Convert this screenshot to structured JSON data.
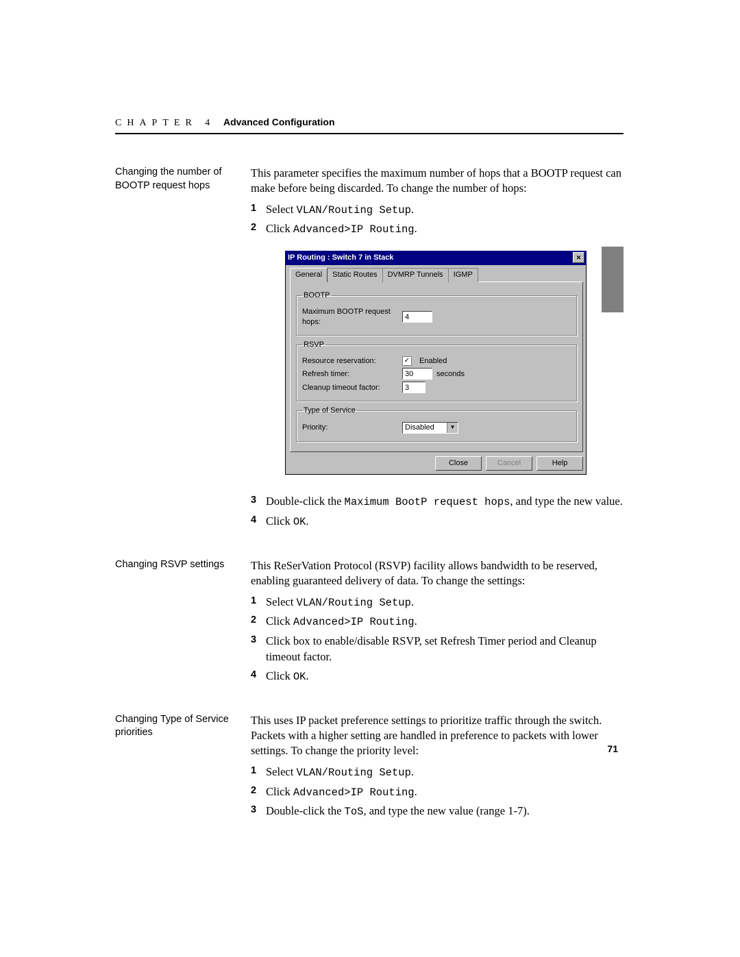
{
  "header": {
    "chapter_label": "CHAPTER 4",
    "title": "Advanced Configuration"
  },
  "sections": {
    "bootp": {
      "side_label": "Changing the number of BOOTP request hops",
      "intro": "This parameter specifies the maximum number of hops that a BOOTP request can make before being discarded. To change the number of hops:",
      "step1_pre": "Select ",
      "step1_mono": "VLAN/Routing Setup",
      "step1_post": ".",
      "step2_pre": "Click ",
      "step2_mono": "Advanced>IP Routing",
      "step2_post": ".",
      "step3_pre": "Double-click the ",
      "step3_mono": "Maximum BootP request hops",
      "step3_post": ", and type the new value.",
      "step4_pre": "Click ",
      "step4_mono": "OK",
      "step4_post": "."
    },
    "rsvp": {
      "side_label": "Changing RSVP settings",
      "intro": "This ReSerVation Protocol (RSVP) facility allows bandwidth to be reserved, enabling guaranteed delivery of data. To change the settings:",
      "step1_pre": "Select ",
      "step1_mono": "VLAN/Routing Setup",
      "step1_post": ".",
      "step2_pre": "Click ",
      "step2_mono": "Advanced>IP Routing",
      "step2_post": ".",
      "step3": "Click box to enable/disable RSVP, set Refresh Timer period and Cleanup timeout factor.",
      "step4_pre": "Click ",
      "step4_mono": "OK",
      "step4_post": "."
    },
    "tos": {
      "side_label": "Changing Type of Service priorities",
      "intro": "This uses IP packet preference settings to prioritize traffic through the switch. Packets with a higher setting are handled in preference to packets with lower settings. To change the priority level:",
      "step1_pre": "Select ",
      "step1_mono": "VLAN/Routing Setup",
      "step1_post": ".",
      "step2_pre": "Click ",
      "step2_mono": "Advanced>IP Routing",
      "step2_post": ".",
      "step3_pre": "Double-click the  ",
      "step3_mono": "ToS",
      "step3_post": ", and type the new value (range 1-7)."
    }
  },
  "dialog": {
    "title": "IP Routing : Switch 7 in Stack",
    "tabs": {
      "general": "General",
      "static": "Static Routes",
      "dvmrp": "DVMRP Tunnels",
      "igmp": "IGMP"
    },
    "groups": {
      "bootp_legend": "BOOTP",
      "bootp_label": "Maximum BOOTP request hops:",
      "bootp_value": "4",
      "rsvp_legend": "RSVP",
      "rsvp_res_label": "Resource reservation:",
      "rsvp_enabled": "Enabled",
      "rsvp_refresh_label": "Refresh timer:",
      "rsvp_refresh_value": "30",
      "rsvp_refresh_unit": "seconds",
      "rsvp_cleanup_label": "Cleanup timeout factor:",
      "rsvp_cleanup_value": "3",
      "tos_legend": "Type of Service",
      "tos_priority_label": "Priority:",
      "tos_priority_value": "Disabled"
    },
    "buttons": {
      "close": "Close",
      "cancel": "Cancel",
      "help": "Help"
    }
  },
  "page_number": "71"
}
